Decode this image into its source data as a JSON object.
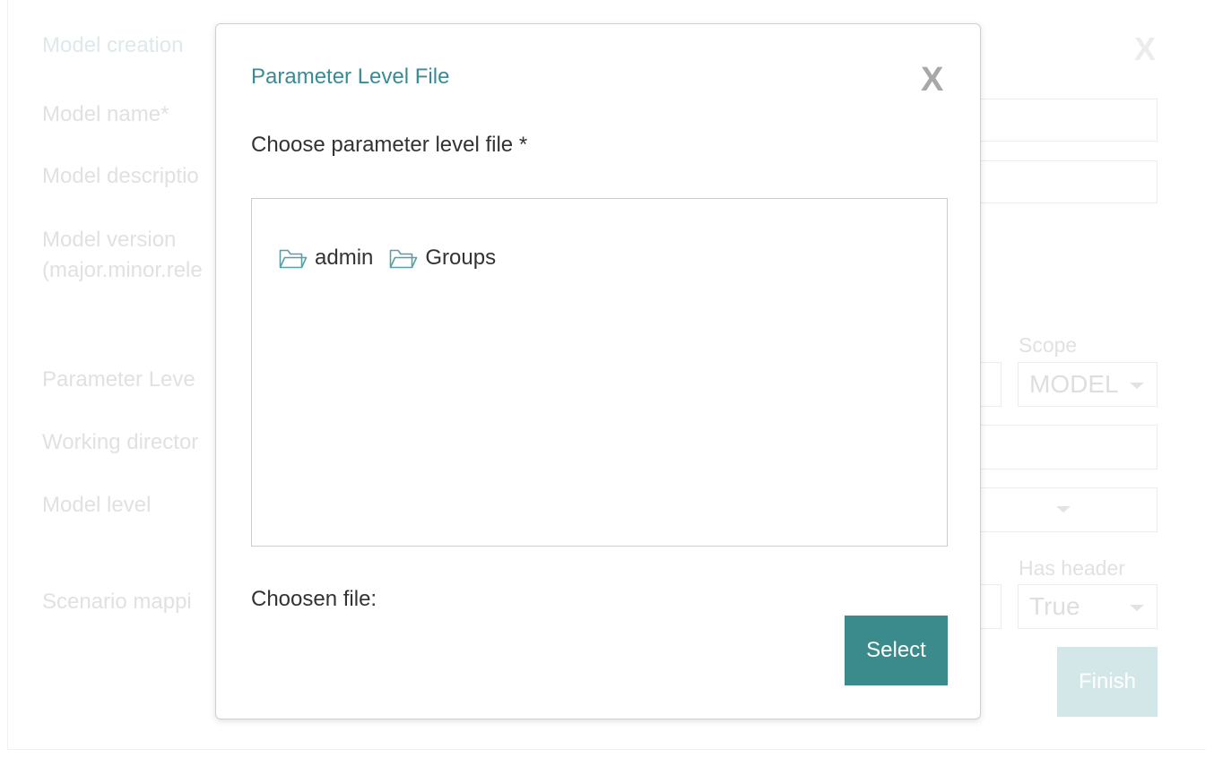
{
  "background_form": {
    "title": "Model creation",
    "close_label": "X",
    "labels": {
      "model_name": "Model name*",
      "model_description": "Model descriptio",
      "model_version_line1": "Model version",
      "model_version_line2": "(major.minor.rele",
      "parameter_level": "Parameter Leve",
      "working_directory": "Working director",
      "model_level": "Model level",
      "scenario_mapping": "Scenario mappi"
    },
    "scope_label": "Scope",
    "scope_value": "MODEL",
    "has_header_label": "Has header",
    "has_header_value": "True",
    "finish_label": "Finish"
  },
  "modal": {
    "title": "Parameter Level File",
    "close_label": "X",
    "choose_label": "Choose parameter level file *",
    "folders": [
      {
        "name": "admin"
      },
      {
        "name": "Groups"
      }
    ],
    "chosen_label": "Choosen file:",
    "select_label": "Select"
  },
  "colors": {
    "accent": "#3b8b8c",
    "title": "#3b8b95",
    "folder_icon": "#5a9ea6"
  },
  "icons": {
    "folder": "folder-open-outline-icon",
    "caret": "caret-down-icon"
  }
}
